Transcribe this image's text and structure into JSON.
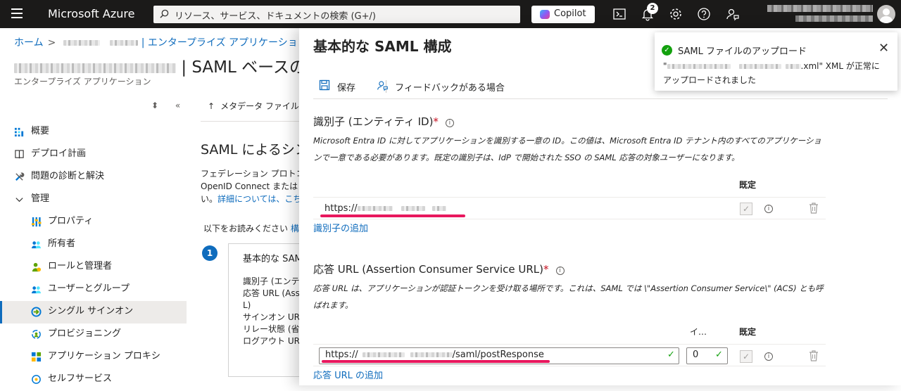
{
  "topbar": {
    "brand": "Microsoft Azure",
    "search_placeholder": "リソース、サービス、ドキュメントの検索 (G+/)",
    "copilot_label": "Copilot",
    "notification_count": "2"
  },
  "breadcrumb": {
    "home": "ホーム",
    "enterprise_apps": "| エンタープライズ アプリケーション"
  },
  "page": {
    "title_suffix": "| SAML ベースの",
    "subtitle": "エンタープライズ アプリケーション"
  },
  "sidebar": {
    "items": [
      {
        "label": "概要",
        "icon": "overview-icon"
      },
      {
        "label": "デプロイ計画",
        "icon": "book-icon"
      },
      {
        "label": "問題の診断と解決",
        "icon": "wrench-icon"
      },
      {
        "label": "管理",
        "icon": "chevron-down-icon"
      },
      {
        "label": "プロパティ",
        "icon": "properties-icon"
      },
      {
        "label": "所有者",
        "icon": "owners-icon"
      },
      {
        "label": "ロールと管理者",
        "icon": "roles-icon"
      },
      {
        "label": "ユーザーとグループ",
        "icon": "users-groups-icon"
      },
      {
        "label": "シングル サインオン",
        "icon": "sso-icon"
      },
      {
        "label": "プロビジョニング",
        "icon": "provisioning-icon"
      },
      {
        "label": "アプリケーション プロキシ",
        "icon": "app-proxy-icon"
      },
      {
        "label": "セルフサービス",
        "icon": "self-service-icon"
      }
    ]
  },
  "middle": {
    "upload_cmd": "メタデータ ファイルを",
    "heading": "SAML によるシン",
    "para_line1": "フェデレーション プロトコル",
    "para_line2": "OpenID Connect または",
    "para_line3": "い。",
    "para_link": "詳細については、こちら",
    "read_text": "以下をお読みください",
    "read_link": "構成",
    "step_number": "1",
    "card_title": "基本的な SAM",
    "card_lines": [
      "識別子 (エンテ",
      "応答 URL (Ass",
      "L)",
      "サインオン URL",
      "リレー状態 (省",
      "ログアウト URL"
    ]
  },
  "blade": {
    "title": "基本的な SAML 構成",
    "save_label": "保存",
    "feedback_label": "フィードバックがある場合",
    "identifier": {
      "title": "識別子 (エンティティ ID)",
      "required_mark": "*",
      "description": "Microsoft Entra ID に対してアプリケーションを識別する一意の ID。この値は、Microsoft Entra ID テナント内のすべてのアプリケーションで一意である必要があります。既定の識別子は、IdP で開始された SSO の SAML 応答の対象ユーザーになります。",
      "default_header": "既定",
      "value_prefix": "https://",
      "add_link": "識別子の追加"
    },
    "reply_url": {
      "title": "応答 URL (Assertion Consumer Service URL)",
      "required_mark": "*",
      "description": "応答 URL は、アプリケーションが認証トークンを受け取る場所です。これは、SAML では \\\"Assertion Consumer Service\\\" (ACS) とも呼ばれます。",
      "index_header": "イ…",
      "default_header": "既定",
      "value_prefix": "https://",
      "value_suffix": "/saml/postResponse",
      "index_value": "0",
      "add_link": "応答 URL の追加"
    }
  },
  "toast": {
    "title": "SAML ファイルのアップロード",
    "message_prefix": "\"",
    "message_suffix": ".xml\" XML が正常にアップロードされました"
  },
  "colors": {
    "accent": "#0f6cbd",
    "topbar": "#1b1a19",
    "success": "#13a10e",
    "annotation_underline": "#e8175d",
    "required": "#c50f1f"
  }
}
